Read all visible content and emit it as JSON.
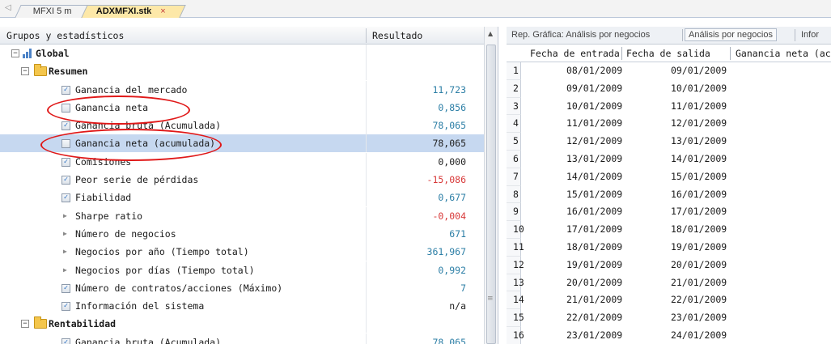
{
  "tabs": {
    "scroll_arrow": "◁",
    "items": [
      {
        "label": "MFXI 5 m",
        "active": false
      },
      {
        "label": "ADXMFXI.stk",
        "active": true,
        "close": "×"
      }
    ]
  },
  "left_panel": {
    "header": {
      "col1": "Grupos y estadísticos",
      "col2": "Resultado"
    },
    "rows": [
      {
        "kind": "group",
        "label": "Global",
        "value": "",
        "expander": "−"
      },
      {
        "kind": "folder",
        "label": "Resumen",
        "value": "",
        "expander": "−"
      },
      {
        "kind": "check",
        "checked": true,
        "label": "Ganancia del mercado",
        "value": "11,723",
        "tone": "pos"
      },
      {
        "kind": "check",
        "checked": false,
        "label": "Ganancia neta",
        "value": "0,856",
        "tone": "pos"
      },
      {
        "kind": "check",
        "checked": true,
        "label": "Ganancia bruta (Acumulada)",
        "value": "78,065",
        "tone": "pos"
      },
      {
        "kind": "check",
        "checked": false,
        "label": "Ganancia neta (acumulada)",
        "value": "78,065",
        "tone": "dark",
        "selected": true
      },
      {
        "kind": "check",
        "checked": true,
        "label": "Comisiones",
        "value": "0,000",
        "tone": "dark"
      },
      {
        "kind": "check",
        "checked": true,
        "label": "Peor serie de pérdidas",
        "value": "-15,086",
        "tone": "neg"
      },
      {
        "kind": "check",
        "checked": true,
        "label": "Fiabilidad",
        "value": "0,677",
        "tone": "pos"
      },
      {
        "kind": "arrow",
        "label": "Sharpe ratio",
        "value": "-0,004",
        "tone": "neg"
      },
      {
        "kind": "arrow",
        "label": "Número de negocios",
        "value": "671",
        "tone": "pos"
      },
      {
        "kind": "arrow",
        "label": "Negocios por año (Tiempo total)",
        "value": "361,967",
        "tone": "pos"
      },
      {
        "kind": "arrow",
        "label": "Negocios por días (Tiempo total)",
        "value": "0,992",
        "tone": "pos"
      },
      {
        "kind": "check",
        "checked": true,
        "label": "Número de contratos/acciones (Máximo)",
        "value": "7",
        "tone": "pos"
      },
      {
        "kind": "check",
        "checked": true,
        "label": "Información del sistema",
        "value": "n/a",
        "tone": "dark"
      },
      {
        "kind": "folder",
        "label": "Rentabilidad",
        "value": "",
        "expander": "−"
      },
      {
        "kind": "check",
        "checked": true,
        "label": "Ganancia bruta (Acumulada)",
        "value": "78,065",
        "tone": "pos"
      }
    ]
  },
  "right_panel": {
    "tabs": [
      "Rep. Gráfica: Análisis por negocios",
      "Análisis por negocios",
      "Infor"
    ],
    "active_tab": 1,
    "columns": [
      "Fecha de entrada",
      "Fecha de salida",
      "Ganancia neta (ac"
    ],
    "rows": [
      {
        "n": "1",
        "entrada": "08/01/2009",
        "salida": "09/01/2009"
      },
      {
        "n": "2",
        "entrada": "09/01/2009",
        "salida": "10/01/2009"
      },
      {
        "n": "3",
        "entrada": "10/01/2009",
        "salida": "11/01/2009"
      },
      {
        "n": "4",
        "entrada": "11/01/2009",
        "salida": "12/01/2009"
      },
      {
        "n": "5",
        "entrada": "12/01/2009",
        "salida": "13/01/2009"
      },
      {
        "n": "6",
        "entrada": "13/01/2009",
        "salida": "14/01/2009"
      },
      {
        "n": "7",
        "entrada": "14/01/2009",
        "salida": "15/01/2009"
      },
      {
        "n": "8",
        "entrada": "15/01/2009",
        "salida": "16/01/2009"
      },
      {
        "n": "9",
        "entrada": "16/01/2009",
        "salida": "17/01/2009"
      },
      {
        "n": "10",
        "entrada": "17/01/2009",
        "salida": "18/01/2009"
      },
      {
        "n": "11",
        "entrada": "18/01/2009",
        "salida": "19/01/2009"
      },
      {
        "n": "12",
        "entrada": "19/01/2009",
        "salida": "20/01/2009"
      },
      {
        "n": "13",
        "entrada": "20/01/2009",
        "salida": "21/01/2009"
      },
      {
        "n": "14",
        "entrada": "21/01/2009",
        "salida": "22/01/2009"
      },
      {
        "n": "15",
        "entrada": "22/01/2009",
        "salida": "23/01/2009"
      },
      {
        "n": "16",
        "entrada": "23/01/2009",
        "salida": "24/01/2009"
      }
    ]
  },
  "colors": {
    "value_positive": "#2d7fa6",
    "value_negative": "#d83a3a",
    "selection": "#c6d8f0",
    "annotation": "#e01818",
    "active_tab": "#fde8a8"
  }
}
